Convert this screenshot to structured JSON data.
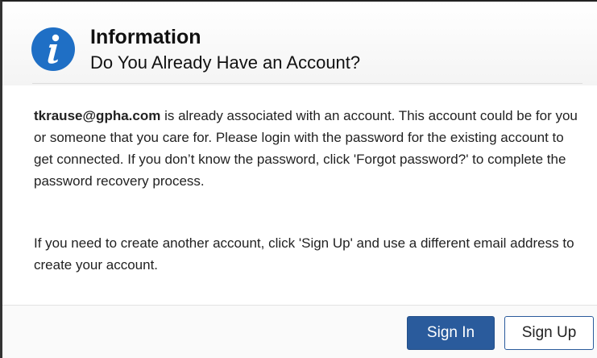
{
  "dialog": {
    "title": "Information",
    "subtitle": "Do You Already Have an Account?",
    "icon": "info-icon",
    "icon_color": "#1f6fc5"
  },
  "message": {
    "email": "tkrause@gpha.com",
    "paragraph1_rest": " is already associated with an account. This account could be for you or someone that you care for. Please login with the password for the existing account to get connected. If you don’t know the password, click 'Forgot password?' to complete the password recovery process.",
    "paragraph2": "If you need to create another account, click 'Sign Up' and use a different email address to create your account."
  },
  "buttons": {
    "sign_in": "Sign In",
    "sign_up": "Sign Up",
    "primary_color": "#2a5b9c"
  }
}
